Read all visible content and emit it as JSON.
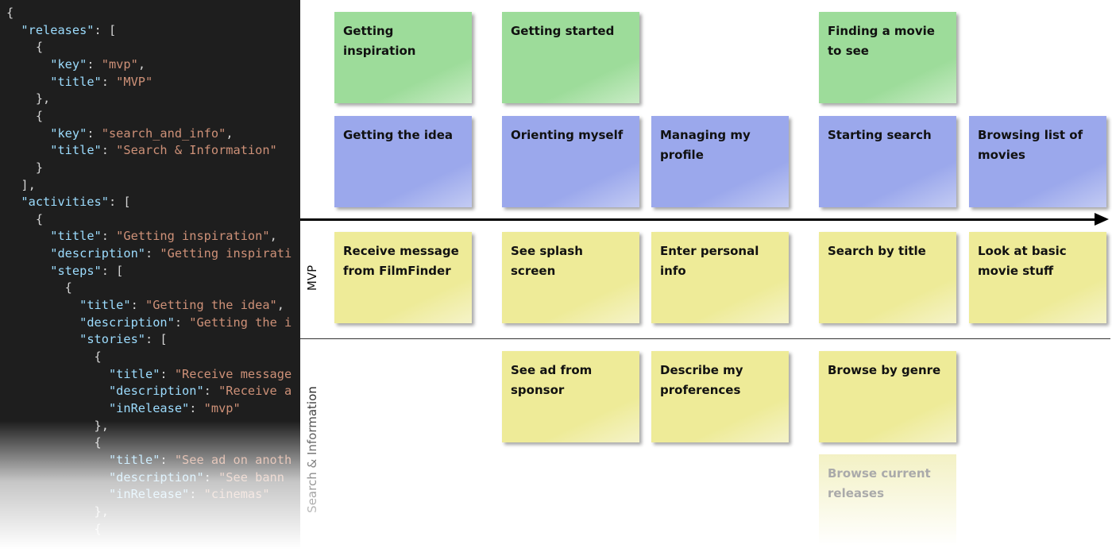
{
  "code_lines": [
    "{",
    "  \"releases\": [",
    "    {",
    "      \"key\": \"mvp\",",
    "      \"title\": \"MVP\"",
    "    },",
    "    {",
    "      \"key\": \"search_and_info\",",
    "      \"title\": \"Search & Information\"",
    "    }",
    "  ],",
    "  \"activities\": [",
    "    {",
    "      \"title\": \"Getting inspiration\",",
    "      \"description\": \"Getting inspirati",
    "      \"steps\": [",
    "        {",
    "          \"title\": \"Getting the idea\",",
    "          \"description\": \"Getting the i",
    "          \"stories\": [",
    "            {",
    "              \"title\": \"Receive message",
    "              \"description\": \"Receive a",
    "              \"inRelease\": \"mvp\"",
    "            },",
    "            {",
    "              \"title\": \"See ad on anoth",
    "              \"description\": \"See bann",
    "              \"inRelease\": \"cinemas\"",
    "            },",
    "            {"
  ],
  "colors": {
    "activity": "#9ddc9a",
    "step": "#9ba8ec",
    "story": "#eeeb98",
    "code_bg": "#1e1e1e",
    "code_key": "#9cdcfe",
    "code_string": "#ce9178"
  },
  "releases": [
    {
      "title": "MVP"
    },
    {
      "title": "Search & Information"
    }
  ],
  "activities": [
    {
      "title": "Getting inspiration",
      "col": 0
    },
    {
      "title": "Getting started",
      "col": 1
    },
    {
      "title": "Finding a movie to see",
      "col": 3
    }
  ],
  "steps": [
    {
      "title": "Getting the idea",
      "col": 0
    },
    {
      "title": "Orienting myself",
      "col": 1
    },
    {
      "title": "Managing my profile",
      "col": 2
    },
    {
      "title": "Starting search",
      "col": 3
    },
    {
      "title": "Browsing list of movies",
      "col": 4
    }
  ],
  "stories": [
    {
      "title": "Receive message from FilmFinder",
      "col": 0,
      "row": 0
    },
    {
      "title": "See splash screen",
      "col": 1,
      "row": 0
    },
    {
      "title": "Enter personal info",
      "col": 2,
      "row": 0
    },
    {
      "title": "Search by title",
      "col": 3,
      "row": 0
    },
    {
      "title": "Look at basic movie stuff",
      "col": 4,
      "row": 0
    },
    {
      "title": "See ad from sponsor",
      "col": 1,
      "row": 1
    },
    {
      "title": "Describe my proferences",
      "col": 2,
      "row": 1
    },
    {
      "title": "Browse by genre",
      "col": 3,
      "row": 1
    },
    {
      "title": "Browse current releases",
      "col": 3,
      "row": 2,
      "faded": true
    }
  ]
}
